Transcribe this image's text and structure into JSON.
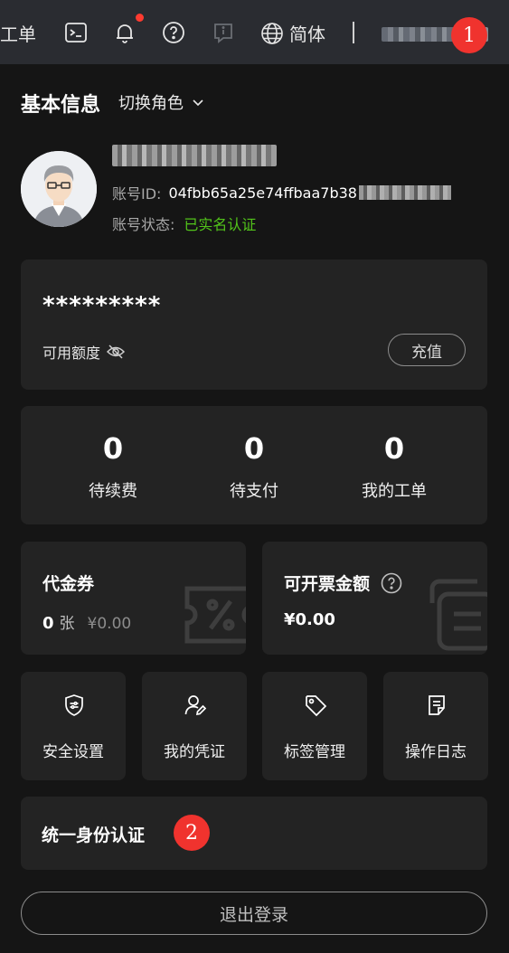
{
  "topbar": {
    "ticket_label": "工单",
    "lang_label": "简体",
    "notification_dot_color": "#ff3b30",
    "icons": [
      "terminal-icon",
      "bell-icon",
      "help-icon",
      "info-icon",
      "globe-icon"
    ]
  },
  "badges": {
    "b1": "1",
    "b2": "2"
  },
  "header": {
    "title": "基本信息",
    "switch_role": "切换角色"
  },
  "profile": {
    "account_id_label": "账号ID:",
    "account_id_value": "04fbb65a25e74ffbaa7b38",
    "status_label": "账号状态:",
    "status_value": "已实名认证",
    "status_color": "#52c41a"
  },
  "balance": {
    "value": "*********",
    "available_label": "可用额度",
    "recharge_label": "充值"
  },
  "stats": [
    {
      "value": "0",
      "label": "待续费"
    },
    {
      "value": "0",
      "label": "待支付"
    },
    {
      "value": "0",
      "label": "我的工单"
    }
  ],
  "voucher": {
    "title": "代金券",
    "count": "0",
    "unit": "张",
    "amount": "¥0.00"
  },
  "invoice": {
    "title": "可开票金额",
    "amount": "¥0.00"
  },
  "quick_actions": [
    {
      "label": "安全设置",
      "icon": "shield-icon"
    },
    {
      "label": "我的凭证",
      "icon": "user-edit-icon"
    },
    {
      "label": "标签管理",
      "icon": "tag-icon"
    },
    {
      "label": "操作日志",
      "icon": "log-icon"
    }
  ],
  "identity": {
    "title": "统一身份认证"
  },
  "logout_label": "退出登录"
}
